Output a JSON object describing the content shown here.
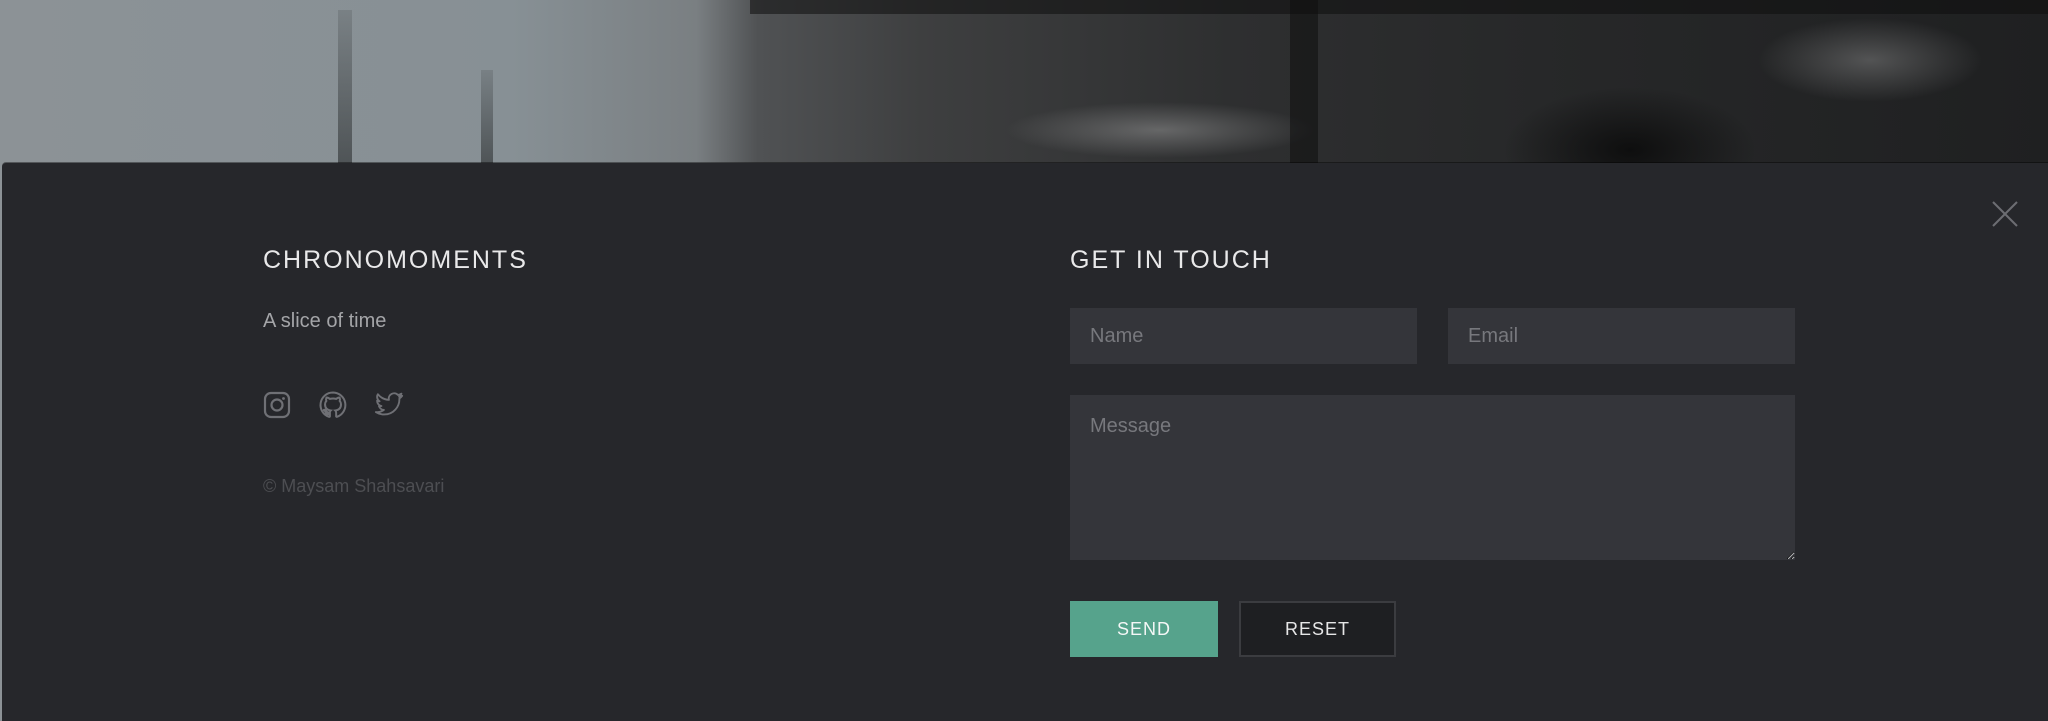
{
  "brand": {
    "title": "CHRONOMOMENTS",
    "tagline": "A slice of time",
    "copyright": "© Maysam Shahsavari",
    "socials": [
      {
        "icon": "instagram-icon"
      },
      {
        "icon": "github-icon"
      },
      {
        "icon": "twitter-icon"
      }
    ]
  },
  "contact": {
    "title": "GET IN TOUCH",
    "name_placeholder": "Name",
    "email_placeholder": "Email",
    "message_placeholder": "Message",
    "send_label": "SEND",
    "reset_label": "RESET"
  },
  "colors": {
    "panel_bg": "#26272b",
    "field_bg": "#34353a",
    "accent": "#56a38c",
    "icon": "#6f7075"
  },
  "close_icon": "close-icon"
}
